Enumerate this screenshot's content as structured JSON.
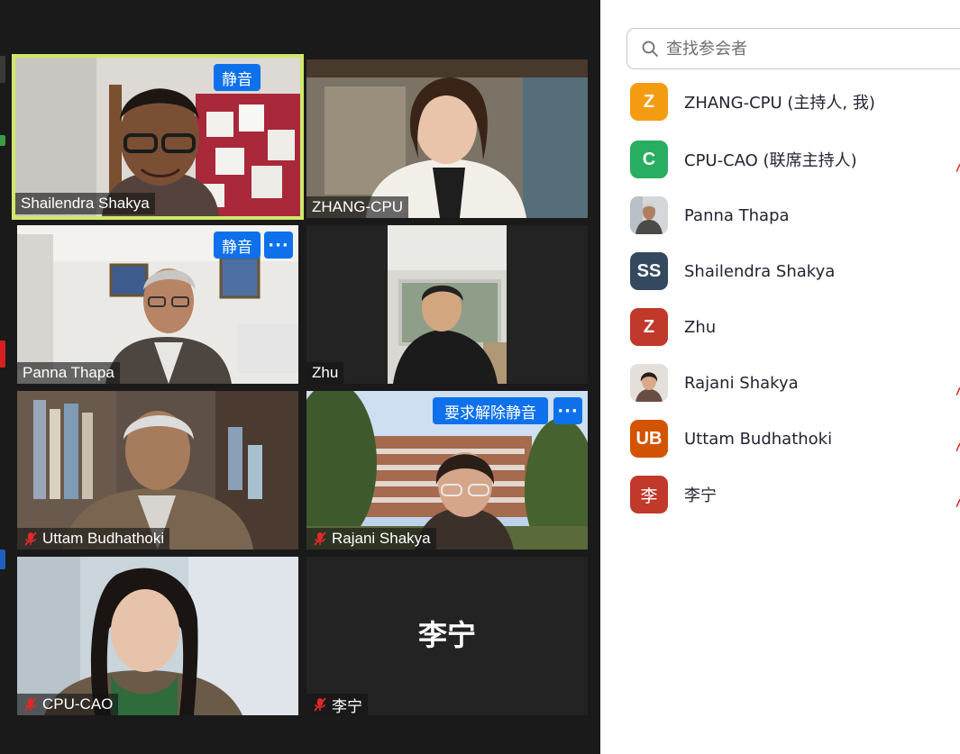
{
  "gallery": {
    "tiles": [
      {
        "name": "Shailendra Shakya",
        "action_label": "静音",
        "muted": false
      },
      {
        "name": "ZHANG-CPU",
        "muted": false
      },
      {
        "name": "Panna Thapa",
        "action_label": "静音",
        "more_label": "···",
        "muted": false
      },
      {
        "name": "Zhu",
        "muted": false
      },
      {
        "name": "Uttam Budhathoki",
        "muted": true
      },
      {
        "name": "Rajani Shakya",
        "action_label": "要求解除静音",
        "more_label": "···",
        "muted": true
      },
      {
        "name": "CPU-CAO",
        "muted": true
      },
      {
        "name": "李宁",
        "display_text": "李宁",
        "muted": true
      }
    ]
  },
  "participants_panel": {
    "search_placeholder": "查找参会者",
    "participants": [
      {
        "initials": "Z",
        "name": "ZHANG-CPU (主持人, 我)",
        "avatar_color": "#f39c12"
      },
      {
        "initials": "C",
        "name": "CPU-CAO (联席主持人)",
        "avatar_color": "#27ae60"
      },
      {
        "initials": "",
        "name": "Panna Thapa",
        "avatar_type": "photo"
      },
      {
        "initials": "SS",
        "name": "Shailendra Shakya",
        "avatar_color": "#2c3e50"
      },
      {
        "initials": "Z",
        "name": "Zhu",
        "avatar_color": "#c0392b"
      },
      {
        "initials": "",
        "name": "Rajani Shakya",
        "avatar_type": "photo"
      },
      {
        "initials": "UB",
        "name": "Uttam Budhathoki",
        "avatar_color": "#d35400"
      },
      {
        "initials": "李",
        "name": "李宁",
        "avatar_color": "#c0392b"
      }
    ]
  },
  "colors": {
    "gallery_bg": "#1a1a1a",
    "active_speaker_border": "#cfe86a",
    "zoom_blue": "#0e71eb",
    "muted_red": "#e02828"
  }
}
